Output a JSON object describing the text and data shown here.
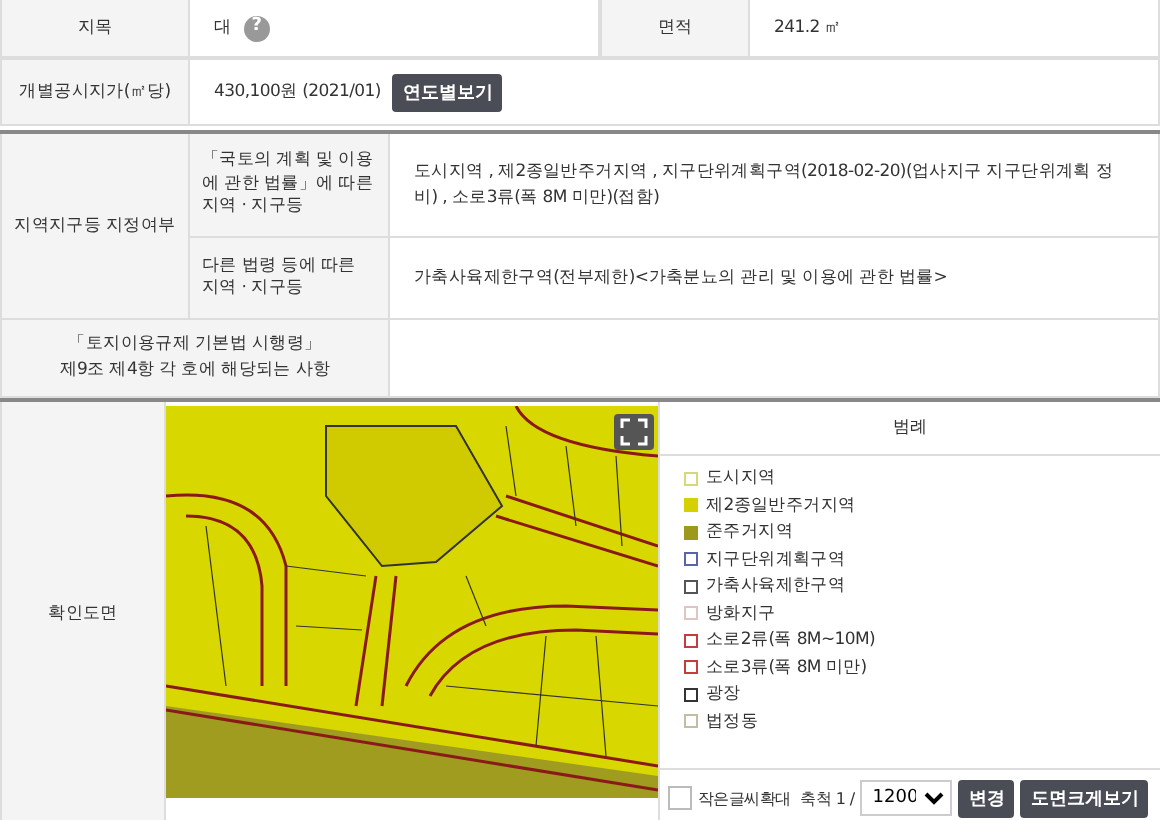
{
  "land": {
    "category_label": "지목",
    "category_value": "대",
    "help_icon": "?",
    "area_label": "면적",
    "area_value": "241.2 ㎡",
    "price_label": "개별공시지가(㎡당)",
    "price_value": "430,100원 (2021/01)",
    "price_button": "연도별보기"
  },
  "zoning": {
    "label": "지역지구등 지정여부",
    "rows": [
      {
        "label": "「국토의 계획 및 이용에 관한 법률」에 따른 지역 · 지구등",
        "value": "도시지역 , 제2종일반주거지역 , 지구단위계획구역(2018-02-20)(업사지구 지구단위계획 정비) , 소로3류(폭 8M 미만)(접함)"
      },
      {
        "label": "다른 법령 등에 따른 지역 · 지구등",
        "value": "가축사육제한구역(전부제한)<가축분뇨의 관리 및 이용에 관한 법률>"
      }
    ]
  },
  "regulation": {
    "label": "「토지이용규제 기본법 시행령」\n제9조 제4항 각 호에 해당되는 사항"
  },
  "map": {
    "label": "확인도면",
    "legend_title": "범례",
    "legend": [
      {
        "name": "도시지역",
        "kind": "outline",
        "color": "#d8d878"
      },
      {
        "name": "제2종일반주거지역",
        "kind": "filled",
        "color": "#d6d000"
      },
      {
        "name": "준주거지역",
        "kind": "filled",
        "color": "#9c9a1c"
      },
      {
        "name": "지구단위계획구역",
        "kind": "outline",
        "color": "#5a64a8"
      },
      {
        "name": "가축사육제한구역",
        "kind": "outline",
        "color": "#555555"
      },
      {
        "name": "방화지구",
        "kind": "outline",
        "color": "#e2c4c4"
      },
      {
        "name": "소로2류(폭 8M~10M)",
        "kind": "outline",
        "color": "#c43c3c"
      },
      {
        "name": "소로3류(폭 8M 미만)",
        "kind": "outline",
        "color": "#c43c3c"
      },
      {
        "name": "광장",
        "kind": "outline",
        "color": "#333333"
      },
      {
        "name": "법정동",
        "kind": "outline",
        "color": "#c4bca4"
      }
    ],
    "enlarge_label": "작은글씨확대",
    "enlarge_checked": false,
    "scale_label": "축척 1 /",
    "scale_value": "1200",
    "change_button": "변경",
    "large_button": "도면크게보기"
  }
}
